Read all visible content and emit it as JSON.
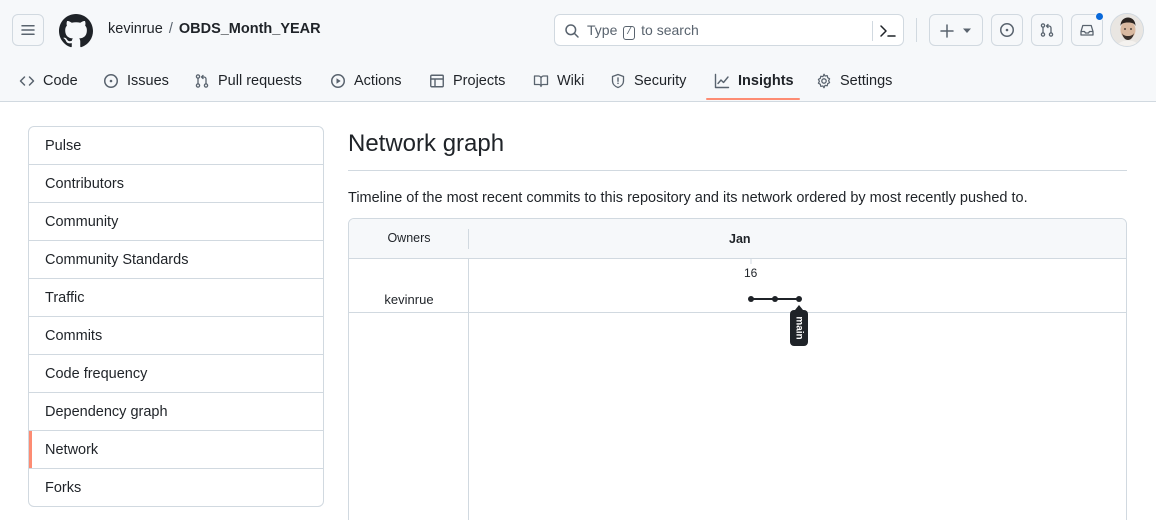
{
  "repo": {
    "owner": "kevinrue",
    "separator": "/",
    "name": "OBDS_Month_YEAR"
  },
  "search": {
    "prefix": "Type",
    "key": "/",
    "suffix": "to search"
  },
  "tabs": [
    {
      "label": "Code",
      "icon": "code-icon"
    },
    {
      "label": "Issues",
      "icon": "issue-icon"
    },
    {
      "label": "Pull requests",
      "icon": "pull-request-icon"
    },
    {
      "label": "Actions",
      "icon": "play-icon"
    },
    {
      "label": "Projects",
      "icon": "table-icon"
    },
    {
      "label": "Wiki",
      "icon": "book-icon"
    },
    {
      "label": "Security",
      "icon": "shield-icon"
    },
    {
      "label": "Insights",
      "icon": "graph-icon",
      "active": true
    },
    {
      "label": "Settings",
      "icon": "gear-icon"
    }
  ],
  "sidebar": {
    "items": [
      {
        "label": "Pulse"
      },
      {
        "label": "Contributors"
      },
      {
        "label": "Community"
      },
      {
        "label": "Community Standards"
      },
      {
        "label": "Traffic"
      },
      {
        "label": "Commits"
      },
      {
        "label": "Code frequency"
      },
      {
        "label": "Dependency graph"
      },
      {
        "label": "Network",
        "selected": true
      },
      {
        "label": "Forks"
      }
    ]
  },
  "main": {
    "title": "Network graph",
    "description": "Timeline of the most recent commits to this repository and its network ordered by most recently pushed to."
  },
  "network": {
    "owners_header": "Owners",
    "month": "Jan",
    "day": "16",
    "owner": "kevinrue",
    "commits": 3,
    "branch": "main"
  },
  "colors": {
    "accent_underline": "#fd8c73",
    "notification": "#0969da",
    "border": "#d1d9e0",
    "header_bg": "#f6f8fa"
  }
}
